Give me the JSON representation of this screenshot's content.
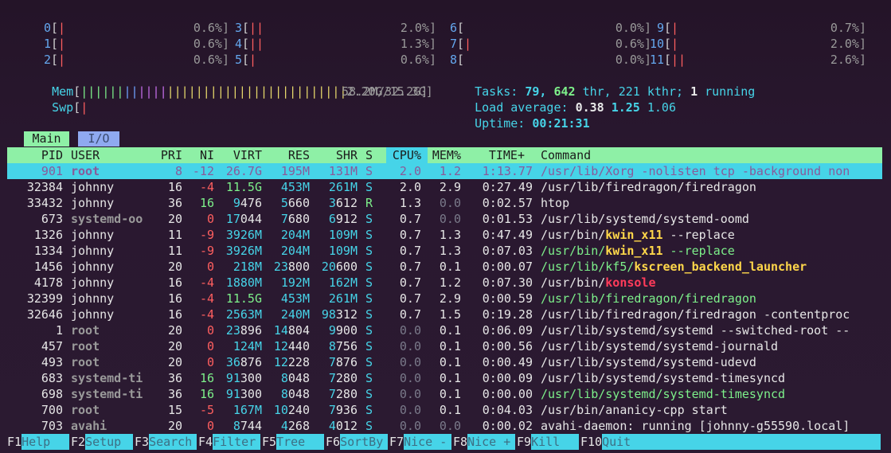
{
  "cpus": [
    {
      "id": "0",
      "bar": "|",
      "pct": "0.6%]"
    },
    {
      "id": "1",
      "bar": "|",
      "pct": "0.6%]"
    },
    {
      "id": "2",
      "bar": "|",
      "pct": "0.6%]"
    },
    {
      "id": "3",
      "bar": "||",
      "pct": "2.0%]"
    },
    {
      "id": "4",
      "bar": "||",
      "pct": "1.3%]"
    },
    {
      "id": "5",
      "bar": "|",
      "pct": "0.6%]"
    },
    {
      "id": "6",
      "bar": "",
      "pct": "0.0%]"
    },
    {
      "id": "7",
      "bar": "|",
      "pct": "0.6%]"
    },
    {
      "id": "8",
      "bar": "",
      "pct": "0.0%]"
    },
    {
      "id": "9",
      "bar": "|",
      "pct": "0.7%]"
    },
    {
      "id": "10",
      "bar": "|",
      "pct": "2.0%]"
    },
    {
      "id": "11",
      "bar": "||",
      "pct": "2.6%]"
    }
  ],
  "mem": {
    "label": "Mem",
    "value": "2.20G/15.3G]"
  },
  "swp": {
    "label": "Swp",
    "value": "58.2M/32.2G]"
  },
  "tasks": {
    "label": "Tasks:",
    "tasks": "79,",
    "threads": "642",
    "thr_label": "thr,",
    "kthr": "221 kthr;",
    "running": "1",
    "running_label": "running"
  },
  "load": {
    "label": "Load average:",
    "l1": "0.38",
    "l5": "1.25",
    "l15": "1.06"
  },
  "uptime": {
    "label": "Uptime:",
    "value": "00:21:31"
  },
  "tabs": {
    "main": "Main",
    "io": "I/O"
  },
  "columns": [
    "PID",
    "USER",
    "PRI",
    "NI",
    "VIRT",
    "RES",
    "SHR",
    "S",
    "CPU%",
    "MEM%",
    "TIME+",
    "Command"
  ],
  "processes": [
    {
      "pid": "901",
      "user": "root",
      "pri": "8",
      "ni": "-12",
      "virt": "26.7G",
      "res": "195M",
      "shr": "131M",
      "s": "S",
      "cpu": "2.0",
      "mem": "1.2",
      "time": "1:13.77",
      "cmd": "/usr/lib/Xorg -nolisten tcp -background non"
    },
    {
      "pid": "32384",
      "user": "johnny",
      "pri": "16",
      "ni": "-4",
      "virt": "11.5G",
      "res": "453M",
      "shr": "261M",
      "s": "S",
      "cpu": "2.0",
      "mem": "2.9",
      "time": "0:27.49",
      "cmd": "/usr/lib/firedragon/firedragon"
    },
    {
      "pid": "33432",
      "user": "johnny",
      "pri": "36",
      "ni": "16",
      "virt": "9476",
      "res": "5660",
      "shr": "3612",
      "s": "R",
      "cpu": "1.3",
      "mem": "0.0",
      "time": "0:02.57",
      "cmd": "htop"
    },
    {
      "pid": "673",
      "user": "systemd-oo",
      "pri": "20",
      "ni": "0",
      "virt": "17044",
      "res": "7680",
      "shr": "6912",
      "s": "S",
      "cpu": "0.7",
      "mem": "0.0",
      "time": "0:01.53",
      "cmd": "/usr/lib/systemd/systemd-oomd"
    },
    {
      "pid": "1326",
      "user": "johnny",
      "pri": "11",
      "ni": "-9",
      "virt": "3926M",
      "res": "204M",
      "shr": "109M",
      "s": "S",
      "cpu": "0.7",
      "mem": "1.3",
      "time": "0:47.49",
      "cmd_a": "/usr/bin/",
      "cmd_b": "kwin_x11",
      "cmd_c": " --replace"
    },
    {
      "pid": "1334",
      "user": "johnny",
      "pri": "11",
      "ni": "-9",
      "virt": "3926M",
      "res": "204M",
      "shr": "109M",
      "s": "S",
      "cpu": "0.7",
      "mem": "1.3",
      "time": "0:07.03",
      "cmd_a": "/usr/bin/",
      "cmd_b": "kwin_x11",
      "cmd_c": " --replace"
    },
    {
      "pid": "1456",
      "user": "johnny",
      "pri": "20",
      "ni": "0",
      "virt": "218M",
      "res": "23800",
      "shr": "20600",
      "s": "S",
      "cpu": "0.7",
      "mem": "0.1",
      "time": "0:00.07",
      "cmd_a": "/usr/lib/kf5/",
      "cmd_b": "kscreen_backend_launcher",
      "cmd_c": ""
    },
    {
      "pid": "4178",
      "user": "johnny",
      "pri": "16",
      "ni": "-4",
      "virt": "1880M",
      "res": "192M",
      "shr": "162M",
      "s": "S",
      "cpu": "0.7",
      "mem": "1.2",
      "time": "0:07.30",
      "cmd_a": "/usr/bin/",
      "cmd_b": "konsole",
      "cmd_c": ""
    },
    {
      "pid": "32399",
      "user": "johnny",
      "pri": "16",
      "ni": "-4",
      "virt": "11.5G",
      "res": "453M",
      "shr": "261M",
      "s": "S",
      "cpu": "0.7",
      "mem": "2.9",
      "time": "0:00.59",
      "cmd": "/usr/lib/firedragon/firedragon"
    },
    {
      "pid": "32646",
      "user": "johnny",
      "pri": "16",
      "ni": "-4",
      "virt": "2563M",
      "res": "240M",
      "shr": "98312",
      "s": "S",
      "cpu": "0.7",
      "mem": "1.5",
      "time": "0:19.28",
      "cmd": "/usr/lib/firedragon/firedragon -contentproc"
    },
    {
      "pid": "1",
      "user": "root",
      "pri": "20",
      "ni": "0",
      "virt": "23896",
      "res": "14804",
      "shr": "9900",
      "s": "S",
      "cpu": "0.0",
      "mem": "0.1",
      "time": "0:06.09",
      "cmd": "/usr/lib/systemd/systemd --switched-root --"
    },
    {
      "pid": "457",
      "user": "root",
      "pri": "20",
      "ni": "0",
      "virt": "124M",
      "res": "12440",
      "shr": "8756",
      "s": "S",
      "cpu": "0.0",
      "mem": "0.1",
      "time": "0:00.56",
      "cmd": "/usr/lib/systemd/systemd-journald"
    },
    {
      "pid": "493",
      "user": "root",
      "pri": "20",
      "ni": "0",
      "virt": "36876",
      "res": "12228",
      "shr": "7876",
      "s": "S",
      "cpu": "0.0",
      "mem": "0.1",
      "time": "0:00.49",
      "cmd": "/usr/lib/systemd/systemd-udevd"
    },
    {
      "pid": "683",
      "user": "systemd-ti",
      "pri": "36",
      "ni": "16",
      "virt": "91300",
      "res": "8048",
      "shr": "7280",
      "s": "S",
      "cpu": "0.0",
      "mem": "0.1",
      "time": "0:00.09",
      "cmd": "/usr/lib/systemd/systemd-timesyncd"
    },
    {
      "pid": "698",
      "user": "systemd-ti",
      "pri": "36",
      "ni": "16",
      "virt": "91300",
      "res": "8048",
      "shr": "7280",
      "s": "S",
      "cpu": "0.0",
      "mem": "0.1",
      "time": "0:00.00",
      "cmd": "/usr/lib/systemd/systemd-timesyncd"
    },
    {
      "pid": "700",
      "user": "root",
      "pri": "15",
      "ni": "-5",
      "virt": "167M",
      "res": "10240",
      "shr": "7936",
      "s": "S",
      "cpu": "0.0",
      "mem": "0.1",
      "time": "0:04.03",
      "cmd": "/usr/bin/ananicy-cpp start"
    },
    {
      "pid": "703",
      "user": "avahi",
      "pri": "20",
      "ni": "0",
      "virt": "8744",
      "res": "4268",
      "shr": "4012",
      "s": "S",
      "cpu": "0.0",
      "mem": "0.0",
      "time": "0:00.02",
      "cmd": "avahi-daemon: running [johnny-g55590.local]"
    }
  ],
  "fkeys": [
    {
      "key": "F1",
      "label": "Help  "
    },
    {
      "key": "F2",
      "label": "Setup "
    },
    {
      "key": "F3",
      "label": "Search"
    },
    {
      "key": "F4",
      "label": "Filter"
    },
    {
      "key": "F5",
      "label": "Tree  "
    },
    {
      "key": "F6",
      "label": "SortBy"
    },
    {
      "key": "F7",
      "label": "Nice -"
    },
    {
      "key": "F8",
      "label": "Nice +"
    },
    {
      "key": "F9",
      "label": "Kill  "
    },
    {
      "key": "F10",
      "label": "Quit"
    }
  ],
  "colors": {
    "accent": "#46d4e8",
    "header": "#8ef0a6",
    "io_tab": "#8fa9f0",
    "red": "#ff5f5f",
    "green": "#7df08a"
  }
}
